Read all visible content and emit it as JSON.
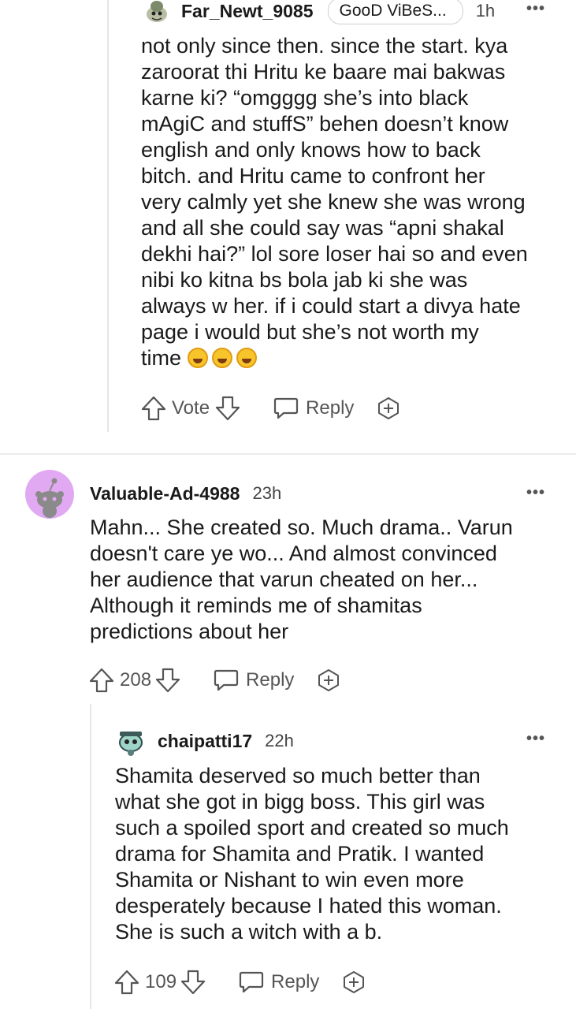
{
  "comments": [
    {
      "username": "Far_Newt_9085",
      "flair": "GooD ViBeS...",
      "time": "1h",
      "text": "not only since then. since the start. kya\nzaroorat thi Hritu ke baare mai bakwas\nkarne ki? “omgggg she’s into black\nmAgiC and stuffS” behen doesn’t know\nenglish and only knows how to back\nbitch. and Hritu came to confront her\nvery calmly yet she knew she was wrong\nand all she could say was “apni shakal\ndekhi hai?” lol sore loser hai so and even\nnibi ko kitna bs bola jab ki she was\nalways w her. if i could start a divya hate\npage i would but she’s not worth my\ntime",
      "emoji": [
        "rolling-laughing-emoji",
        "rolling-laughing-emoji",
        "rolling-laughing-emoji"
      ],
      "vote_label": "Vote",
      "reply_label": "Reply"
    },
    {
      "username": "Valuable-Ad-4988",
      "time": "23h",
      "text": "Mahn... She created so. Much drama.. Varun\ndoesn't care ye wo... And almost convinced\nher audience that varun cheated on her...\nAlthough it reminds me of shamitas\npredictions about her",
      "vote_label": "208",
      "reply_label": "Reply"
    },
    {
      "username": "chaipatti17",
      "time": "22h",
      "text": "Shamita deserved so much better than\nwhat she got in bigg boss. This girl was\nsuch a spoiled sport and created so much\ndrama for Shamita and Pratik. I wanted\nShamita or Nishant to win even more\ndesperately because I hated this woman.\nShe is such a witch with a b.",
      "vote_label": "109",
      "reply_label": "Reply"
    }
  ],
  "more_label": "•••",
  "colors": {
    "avatar_purple": "#e2a9f3",
    "snoo_gray": "#8a8a8a",
    "divider": "#ebebeb",
    "thread_line": "#e6e6e6"
  }
}
